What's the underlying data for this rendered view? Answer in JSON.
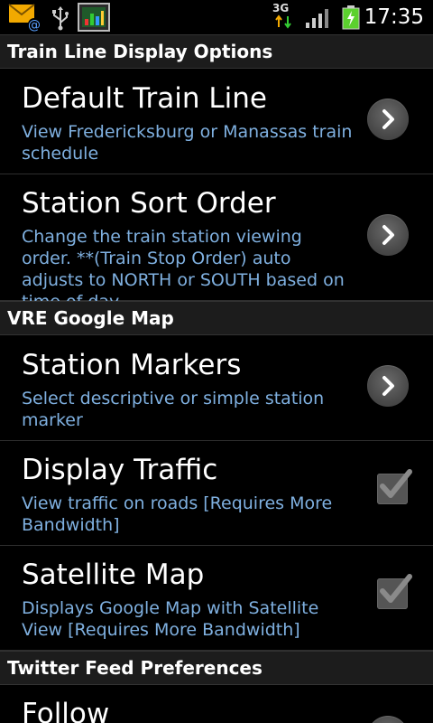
{
  "status_bar": {
    "time": "17:35",
    "network": "3G"
  },
  "sections": [
    {
      "header": "Train Line Display Options",
      "items": [
        {
          "title": "Default Train Line",
          "summary": "View Fredericksburg or Manassas train schedule",
          "widget": "chevron"
        },
        {
          "title": "Station Sort Order",
          "summary": "Change the train station viewing order. **(Train Stop Order) auto adjusts to NORTH or SOUTH based on time of day",
          "widget": "chevron"
        }
      ]
    },
    {
      "header": "VRE Google Map",
      "items": [
        {
          "title": "Station Markers",
          "summary": "Select descriptive or simple station marker",
          "widget": "chevron"
        },
        {
          "title": "Display Traffic",
          "summary": "View traffic on roads [Requires More Bandwidth]",
          "widget": "checkbox",
          "checked": true
        },
        {
          "title": "Satellite Map",
          "summary": "Displays Google Map with Satellite View [Requires More Bandwidth]",
          "widget": "checkbox",
          "checked": true
        }
      ]
    },
    {
      "header": "Twitter Feed Preferences",
      "items": [
        {
          "title": "Follow",
          "summary": "",
          "widget": "chevron"
        }
      ]
    }
  ],
  "colors": {
    "background": "#000000",
    "section_header_bg": "#1c1c1c",
    "title_text": "#ffffff",
    "summary_text": "#7fb0e0",
    "checkmark": "#8a8a8a"
  },
  "icons": [
    "email-notification-icon",
    "usb-icon",
    "app-notification-icon",
    "3g-data-icon",
    "signal-strength-icon",
    "battery-charging-icon",
    "chevron-right-icon",
    "checkmark-icon"
  ]
}
